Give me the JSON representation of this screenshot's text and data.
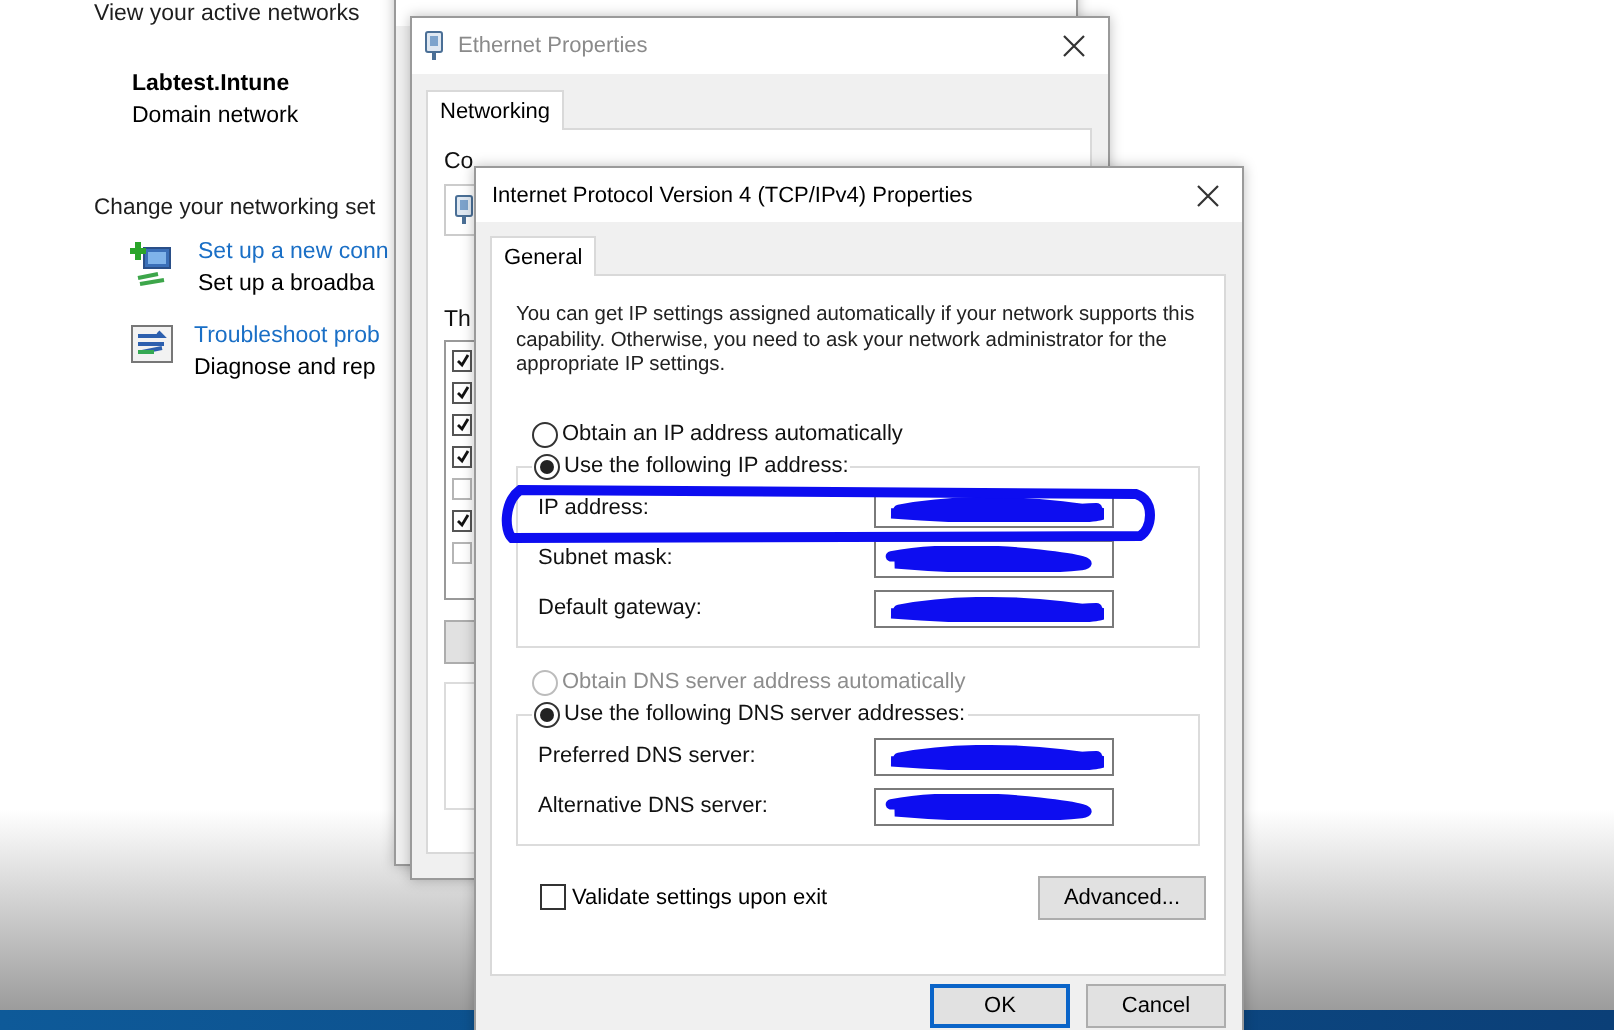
{
  "background_page": {
    "heading": "View your active networks",
    "network_name": "Labtest.Intune",
    "network_type": "Domain network",
    "section_heading": "Change your networking set",
    "tasks": [
      {
        "kind": "setup",
        "link": "Set up a new conn",
        "description": "Set up a broadba"
      },
      {
        "kind": "troubleshoot",
        "link": "Troubleshoot prob",
        "description": "Diagnose and rep"
      }
    ]
  },
  "ethernet_properties": {
    "title": "Ethernet Properties",
    "tabs": [
      {
        "label": "Networking",
        "selected": true
      }
    ],
    "connect_label": "Co",
    "items_label": "Th",
    "components": [
      {
        "checked": true
      },
      {
        "checked": true
      },
      {
        "checked": true
      },
      {
        "checked": true
      },
      {
        "checked": false
      },
      {
        "checked": true
      },
      {
        "checked": false
      }
    ]
  },
  "ipv4_dialog": {
    "title": "Internet Protocol Version 4 (TCP/IPv4) Properties",
    "tabs": [
      {
        "label": "General",
        "selected": true
      }
    ],
    "description": "You can get IP settings assigned automatically if your network supports this capability. Otherwise, you need to ask your network administrator for the appropriate IP settings.",
    "ip_options": [
      {
        "label": "Obtain an IP address automatically",
        "selected": false,
        "disabled": false
      },
      {
        "label": "Use the following IP address:",
        "selected": true,
        "disabled": false
      }
    ],
    "ip_fields": [
      {
        "label": "IP address:"
      },
      {
        "label": "Subnet mask:"
      },
      {
        "label": "Default gateway:"
      }
    ],
    "dns_options": [
      {
        "label": "Obtain DNS server address automatically",
        "selected": false,
        "disabled": true
      },
      {
        "label": "Use the following DNS server addresses:",
        "selected": true,
        "disabled": false
      }
    ],
    "dns_fields": [
      {
        "label": "Preferred DNS server:"
      },
      {
        "label": "Alternative DNS server:"
      }
    ],
    "validate": {
      "label": "Validate settings upon exit",
      "checked": false
    },
    "buttons": {
      "advanced": "Advanced...",
      "ok": "OK",
      "cancel": "Cancel"
    }
  }
}
